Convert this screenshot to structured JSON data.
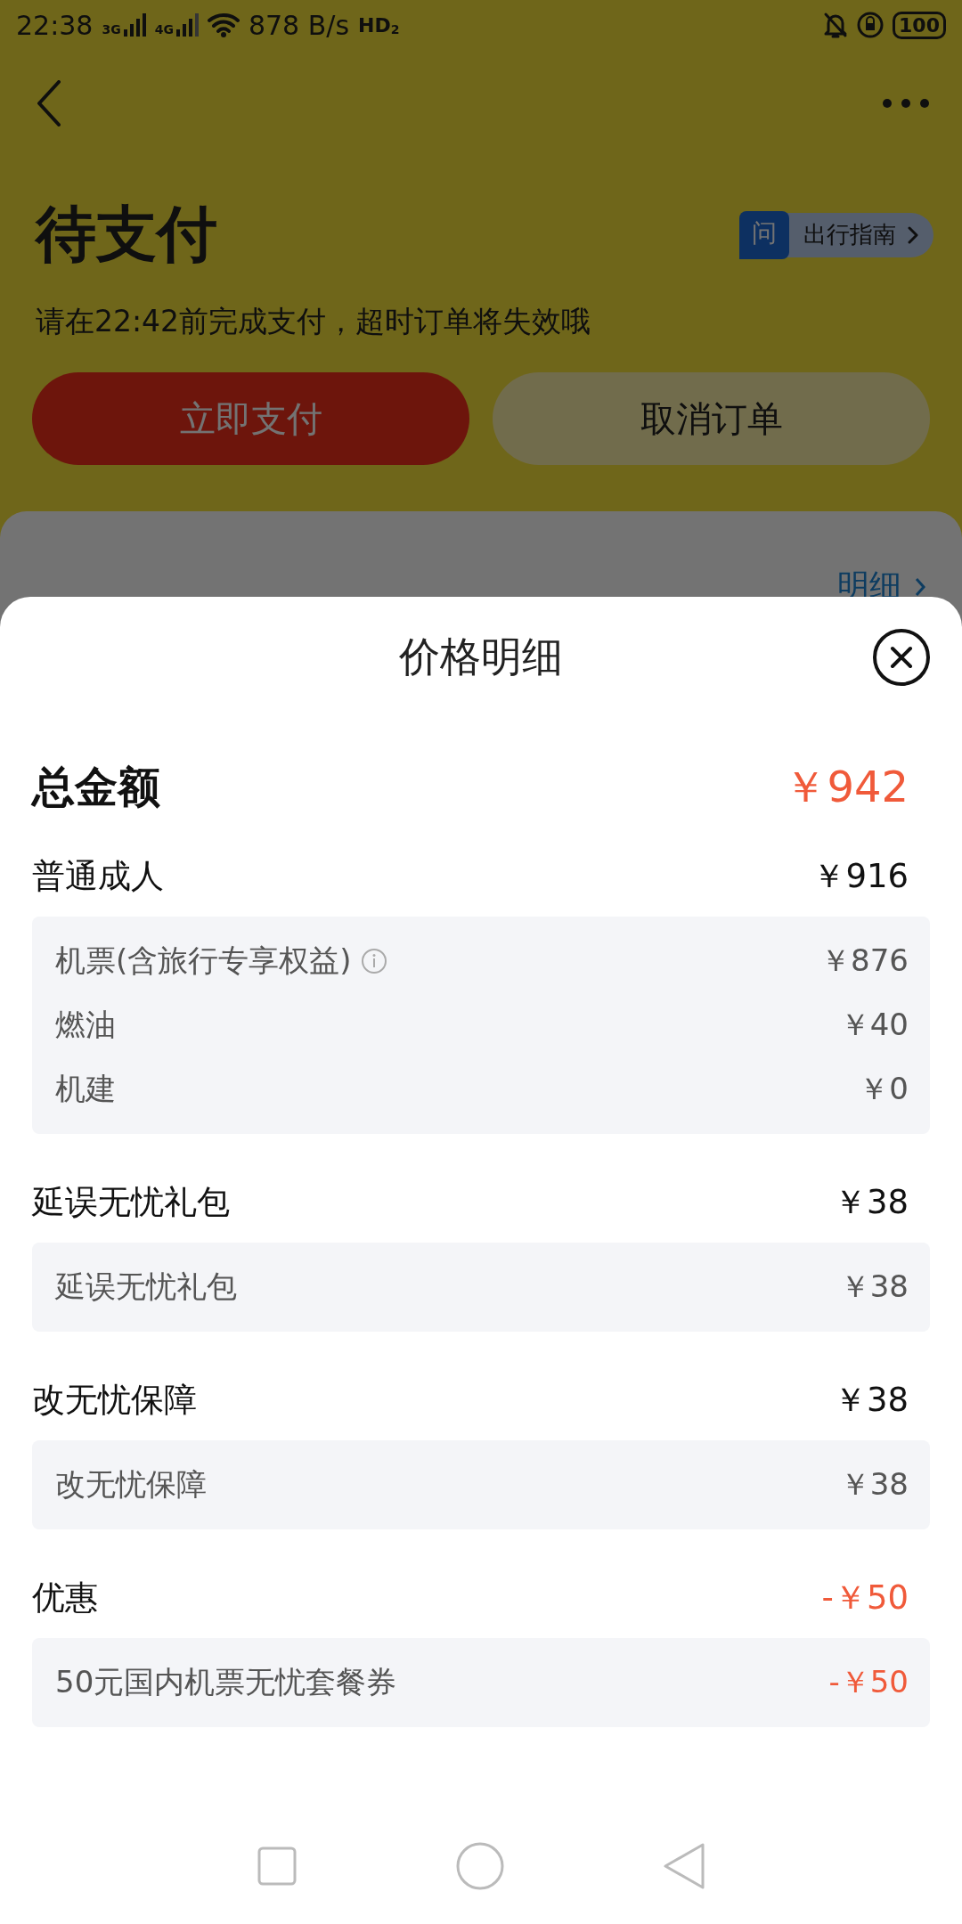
{
  "status_bar": {
    "time": "22:38",
    "signal": [
      {
        "label": "3G"
      },
      {
        "label": "4G"
      }
    ],
    "speed": "878 B/s",
    "hd": "HD",
    "hd_sub": "2",
    "battery": "100"
  },
  "order": {
    "title": "待支付",
    "guide": {
      "badge": "问",
      "label": "出行指南"
    },
    "notice": "请在22:42前完成支付，超时订单将失效哦",
    "buttons": [
      {
        "label": "立即支付",
        "kind": "primary"
      },
      {
        "label": "取消订单",
        "kind": "secondary"
      }
    ],
    "summary": {
      "link": "明细"
    }
  },
  "sheet": {
    "title": "价格明细",
    "total": {
      "label": "总金额",
      "amount": "￥942"
    },
    "sections": [
      {
        "title": "普通成人",
        "amount": "￥916",
        "kind": "charge",
        "items": [
          {
            "label": "机票(含旅行专享权益)",
            "amount": "￥876",
            "has_info": true
          },
          {
            "label": "燃油",
            "amount": "￥40",
            "has_info": false
          },
          {
            "label": "机建",
            "amount": "￥0",
            "has_info": false
          }
        ]
      },
      {
        "title": "延误无忧礼包",
        "amount": "￥38",
        "kind": "charge",
        "items": [
          {
            "label": "延误无忧礼包",
            "amount": "￥38",
            "has_info": false
          }
        ]
      },
      {
        "title": "改无忧保障",
        "amount": "￥38",
        "kind": "charge",
        "items": [
          {
            "label": "改无忧保障",
            "amount": "￥38",
            "has_info": false
          }
        ]
      },
      {
        "title": "优惠",
        "amount": "-￥50",
        "kind": "discount",
        "items": [
          {
            "label": "50元国内机票无忧套餐券",
            "amount": "-￥50",
            "has_info": false
          }
        ]
      }
    ]
  }
}
